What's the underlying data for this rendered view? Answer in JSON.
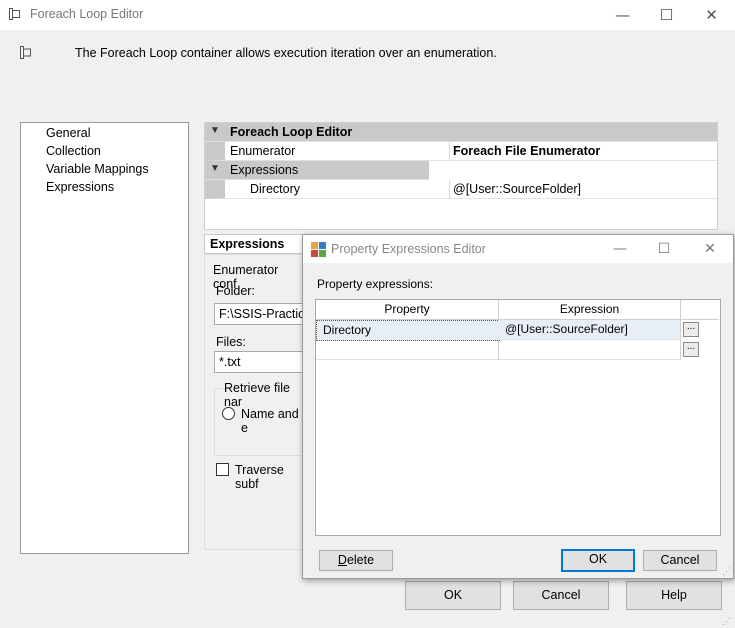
{
  "window": {
    "title": "Foreach Loop Editor",
    "minimize": "—",
    "maximize": "☐",
    "close": "✕"
  },
  "description": "The Foreach Loop container allows execution iteration over an enumeration.",
  "nav": {
    "items": [
      "General",
      "Collection",
      "Variable Mappings",
      "Expressions"
    ],
    "selected": "Collection"
  },
  "property_grid": {
    "category_main": "Foreach Loop Editor",
    "enumerator_label": "Enumerator",
    "enumerator_value": "Foreach File Enumerator",
    "category_expressions": "Expressions",
    "directory_label": "Directory",
    "directory_value": "@[User::SourceFolder]"
  },
  "expressions_header": "Expressions",
  "enumerator_config": {
    "group_label": "Enumerator conf",
    "folder_label": "Folder:",
    "folder_value": "F:\\SSIS-Practice",
    "files_label": "Files:",
    "files_value": "*.txt",
    "retrieve_label": "Retrieve file nar",
    "name_ext_label": "Name and e",
    "traverse_label": "Traverse subf"
  },
  "footer": {
    "ok": "OK",
    "cancel": "Cancel",
    "help": "Help"
  },
  "dialog": {
    "title": "Property Expressions Editor",
    "minimize": "—",
    "maximize": "☐",
    "close": "✕",
    "list_label": "Property expressions:",
    "col_property": "Property",
    "col_expression": "Expression",
    "rows": [
      {
        "property": "Directory",
        "expression": "@[User::SourceFolder]"
      }
    ],
    "ellipsis": "...",
    "delete": "Delete",
    "ok": "OK",
    "cancel": "Cancel"
  },
  "colors": {
    "accent": "#0078d7",
    "category_bg": "#c9c9c9",
    "window_bg": "#f0f0f0"
  }
}
